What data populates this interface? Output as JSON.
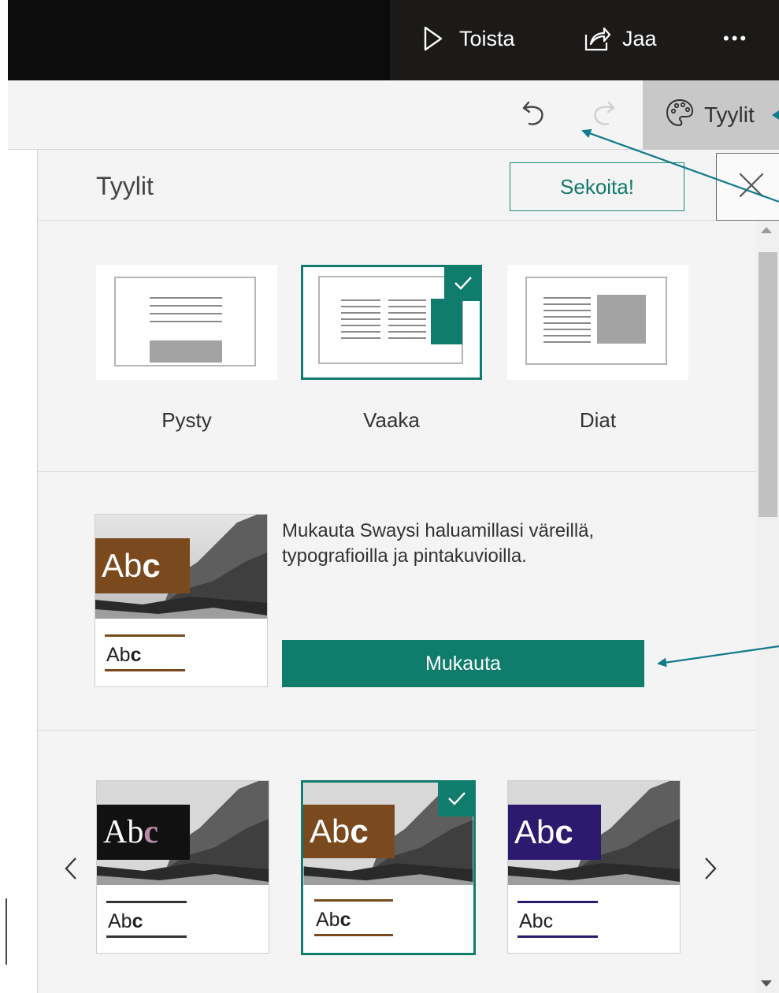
{
  "topbar": {
    "play_label": "Toista",
    "share_label": "Jaa",
    "more_label": "•••"
  },
  "toolbar": {
    "styles_label": "Tyylit"
  },
  "panel": {
    "title": "Tyylit",
    "shuffle_label": "Sekoita!",
    "layouts": [
      {
        "label": "Pysty",
        "selected": false
      },
      {
        "label": "Vaaka",
        "selected": true
      },
      {
        "label": "Diat",
        "selected": false
      }
    ],
    "customize": {
      "description": "Mukauta Swaysi haluamillasi väreillä, typografioilla ja pintakuvioilla.",
      "button_label": "Mukauta",
      "preview_abc_large": "Ab",
      "preview_abc_large_bold": "c",
      "preview_abc_small": "Ab",
      "preview_abc_small_bold": "c"
    },
    "themes": [
      {
        "abc": "Ab",
        "abc_bold": "c",
        "accent": "#111111",
        "rule": "#333333",
        "selected": false
      },
      {
        "abc": "Ab",
        "abc_bold": "c",
        "accent": "#7a4a1e",
        "rule": "#7a4a1e",
        "selected": true
      },
      {
        "abc": "Ab",
        "abc_bold": "c",
        "accent": "#2c1a6e",
        "rule": "#2c1a6e",
        "selected": false
      }
    ]
  },
  "colors": {
    "accent": "#0f7c6c",
    "annotation": "#117a8b",
    "brown": "#7a4a1e"
  }
}
